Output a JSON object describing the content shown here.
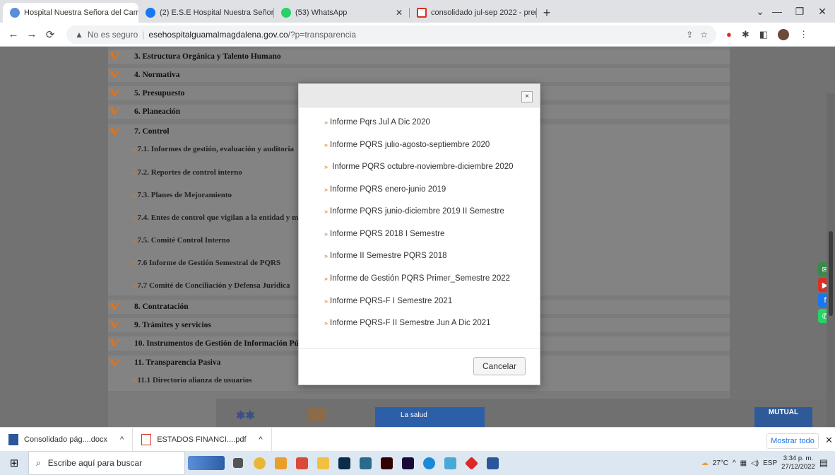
{
  "browser": {
    "tabs": [
      {
        "label": "Hospital Nuestra Señora del Carr",
        "active": true,
        "icon": "hospital-favicon"
      },
      {
        "label": "(2) E.S.E Hospital Nuestra Señora",
        "active": false,
        "icon": "facebook-icon"
      },
      {
        "label": "(53) WhatsApp",
        "active": false,
        "icon": "whatsapp-icon"
      },
      {
        "label": "consolidado jul-sep 2022 - prens",
        "active": false,
        "icon": "gmail-icon"
      }
    ],
    "new_tab": "+",
    "security_label": "No es seguro",
    "url_host": "esehospitalguamalmagdalena.gov.co",
    "url_path": "/?p=transparencia"
  },
  "sections": {
    "s3": "3. Estructura Orgánica y Talento Humano",
    "s4": "4. Normativa",
    "s5": "5. Presupuesto",
    "s6": "6. Planeación",
    "s7": "7. Control",
    "s8": "8. Contratación",
    "s9": "9. Trámites y servicios",
    "s10": "10. Instrumentos de Gestión de Información Pú",
    "s11": "11. Transparencia Pasiva"
  },
  "subitems": {
    "c1": "7.1. Informes de gestión, evaluación y auditoria",
    "c2": "7.2. Reportes de control interno",
    "c3": "7.3. Planes de Mejoramiento",
    "c4": "7.4. Entes de control que vigilan a la entidad y m",
    "c5": "7.5. Comité Control Interno",
    "c6": "7.6 Informe de Gestión Semestral de PQRS",
    "c7": "7.7 Comité de Conciliación y Defensa Jurídica",
    "t1": "11.1 Directorio alianza de usuarios"
  },
  "modal": {
    "close": "×",
    "items": [
      "Informe Pqrs Jul A Dic 2020",
      "Informe PQRS julio-agosto-septiembre 2020",
      " Informe PQRS octubre-noviembre-diciembre 2020",
      "Informe PQRS enero-junio 2019",
      "Informe PQRS junio-diciembre 2019 II Semestre",
      "Informe PQRS 2018 I Semestre",
      "Informe II Semestre PQRS 2018",
      "Informe de Gestión PQRS Primer_Semestre 2022",
      "Informe PQRS-F I Semestre 2021",
      "Informe PQRS-F II Semestre Jun A Dic 2021"
    ],
    "cancel": "Cancelar"
  },
  "logos": {
    "salud": "La salud",
    "mutual": "MUTUAL"
  },
  "downloads": {
    "items": [
      "Consolidado pág....docx",
      "ESTADOS FINANCI....pdf"
    ],
    "show_all": "Mostrar todo"
  },
  "taskbar": {
    "search_placeholder": "Escribe aquí para buscar",
    "weather": "27°C",
    "lang": "ESP",
    "time": "3:34 p. m.",
    "date": "27/12/2022"
  },
  "colors": {
    "accent": "#e0731a",
    "link": "#1a73e8"
  }
}
